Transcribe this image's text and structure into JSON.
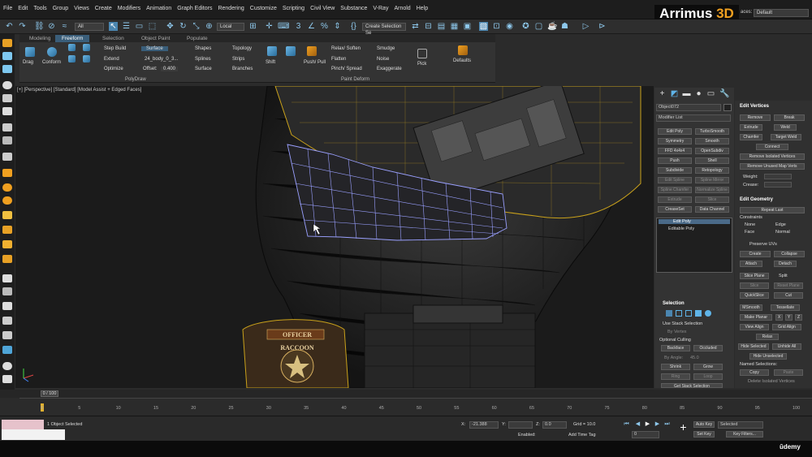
{
  "menu": [
    "File",
    "Edit",
    "Tools",
    "Group",
    "Views",
    "Create",
    "Modifiers",
    "Animation",
    "Graph Editors",
    "Rendering",
    "Customize",
    "Scripting",
    "Civil View",
    "Substance",
    "V-Ray",
    "Arnold",
    "Help"
  ],
  "brand": {
    "name": "Arrimus",
    "accent": "3D"
  },
  "workspace": {
    "label": "aces:",
    "value": "Default"
  },
  "toolbar": {
    "filter": "All",
    "coord": "Local",
    "selection_set": "Create Selection Se"
  },
  "ribbon": {
    "tabs": [
      "Modeling",
      "Freeform",
      "Selection",
      "Object Paint",
      "Populate"
    ],
    "active_tab": "Freeform",
    "polydraw": {
      "drag": "Drag",
      "conform": "Conform",
      "step_build": "Step Build",
      "extend": "Extend",
      "optimize": "Optimize",
      "surface_btn": "Surface",
      "surface_obj": "24_body_0_3...",
      "offset_label": "Offset:",
      "offset_value": "0.400",
      "shapes": "Shapes",
      "splines": "Splines",
      "surface": "Surface",
      "topology": "Topology",
      "strips": "Strips",
      "branches": "Branches",
      "group_label": "PolyDraw"
    },
    "paintdeform": {
      "shift": "Shift",
      "push_pull": "Push/ Pull",
      "relax_soften": "Relax/ Soften",
      "flatten": "Flatten",
      "pinch_spread": "Pinch/ Spread",
      "smudge": "Smudge",
      "noise": "Noise",
      "exaggerate": "Exaggerate",
      "group_label": "Paint Deform"
    },
    "pick": "Pick",
    "defaults": "Defaults"
  },
  "viewport": {
    "label": "[+] [Perspective] [Standard] [Model Assist + Edged Faces]",
    "patch_text_top": "OFFICER",
    "patch_text_mid": "RACCOON"
  },
  "cmd": {
    "object_name": "Object072",
    "modifier_list": "Modifier List",
    "buttons": [
      [
        "Edit Poly",
        "TurboSmooth"
      ],
      [
        "Symmetry",
        "Smooth"
      ],
      [
        "FFD 4x4x4",
        "OpenSubdiv"
      ],
      [
        "Push",
        "Shell"
      ],
      [
        "Subdivide",
        "Retopology"
      ],
      [
        "Edit Spline",
        "Spline Mirror"
      ],
      [
        "Spline Chamfer",
        "Normalize Spline"
      ],
      [
        "Extrude",
        "Slice"
      ],
      [
        "CreaseSet",
        "Data Channel"
      ]
    ],
    "stack": [
      "Edit Poly",
      "Editable Poly"
    ],
    "selection_header": "Selection",
    "use_stack": "Use Stack Selection",
    "by_vertex": "By Vertex",
    "optional_culling": "Optional Culling",
    "backface": "Backface",
    "occluded": "Occluded",
    "by_angle": "By Angle:",
    "by_angle_val": "45.0",
    "shrink": "Shrink",
    "grow": "Grow",
    "ring": "Ring",
    "loop": "Loop",
    "get_stack": "Get Stack Selection"
  },
  "rollout": {
    "edit_vertices": "Edit Vertices",
    "remove": "Remove",
    "break": "Break",
    "extrude": "Extrude",
    "weld": "Weld",
    "chamfer": "Chamfer",
    "target_weld": "Target Weld",
    "connect": "Connect",
    "remove_isolated": "Remove Isolated Vertices",
    "remove_unused": "Remove Unused Map Verts",
    "weight": "Weight:",
    "crease": "Crease:",
    "edit_geometry": "Edit Geometry",
    "repeat_last": "Repeat Last",
    "constraints": "Constraints",
    "none": "None",
    "edge": "Edge",
    "face": "Face",
    "normal": "Normal",
    "preserve_uvs": "Preserve UVs",
    "create": "Create",
    "collapse": "Collapse",
    "attach": "Attach",
    "detach": "Detach",
    "slice_plane": "Slice Plane",
    "split": "Split",
    "slice": "Slice",
    "reset_plane": "Reset Plane",
    "quickslice": "QuickSlice",
    "cut": "Cut",
    "msmooth": "MSmooth",
    "tessellate": "Tessellate",
    "make_planar": "Make Planar",
    "x": "X",
    "y": "Y",
    "z": "Z",
    "view_align": "View Align",
    "grid_align": "Grid Align",
    "relax": "Relax",
    "hide_selected": "Hide Selected",
    "unhide_all": "Unhide All",
    "hide_unselected": "Hide Unselected",
    "named_selections": "Named Selections:",
    "copy": "Copy",
    "paste": "Paste",
    "delete_isolated": "Delete Isolated Vertices"
  },
  "timeline": {
    "frame": "0 / 100",
    "ticks": [
      "0",
      "5",
      "10",
      "15",
      "20",
      "25",
      "30",
      "35",
      "40",
      "45",
      "50",
      "55",
      "60",
      "65",
      "70",
      "75",
      "80",
      "85",
      "90",
      "95",
      "100"
    ]
  },
  "status": {
    "selected": "1 Object Selected",
    "x_label": "X:",
    "x_val": "-21.388",
    "y_label": "Y:",
    "z_label": "Z:",
    "z_val": "0.0",
    "grid": "Grid = 10.0",
    "enabled": "Enabled:",
    "add_time_tag": "Add Time Tag",
    "auto_key": "Auto Key",
    "selected_dd": "Selected",
    "set_key": "Set Key",
    "key_filters": "Key Filters...",
    "frame_field": "0"
  },
  "watermark": "ūdemy",
  "colors": {
    "accent": "#5fb4e8",
    "wire": "#c9a11b",
    "selection": "#9aa0ff"
  }
}
